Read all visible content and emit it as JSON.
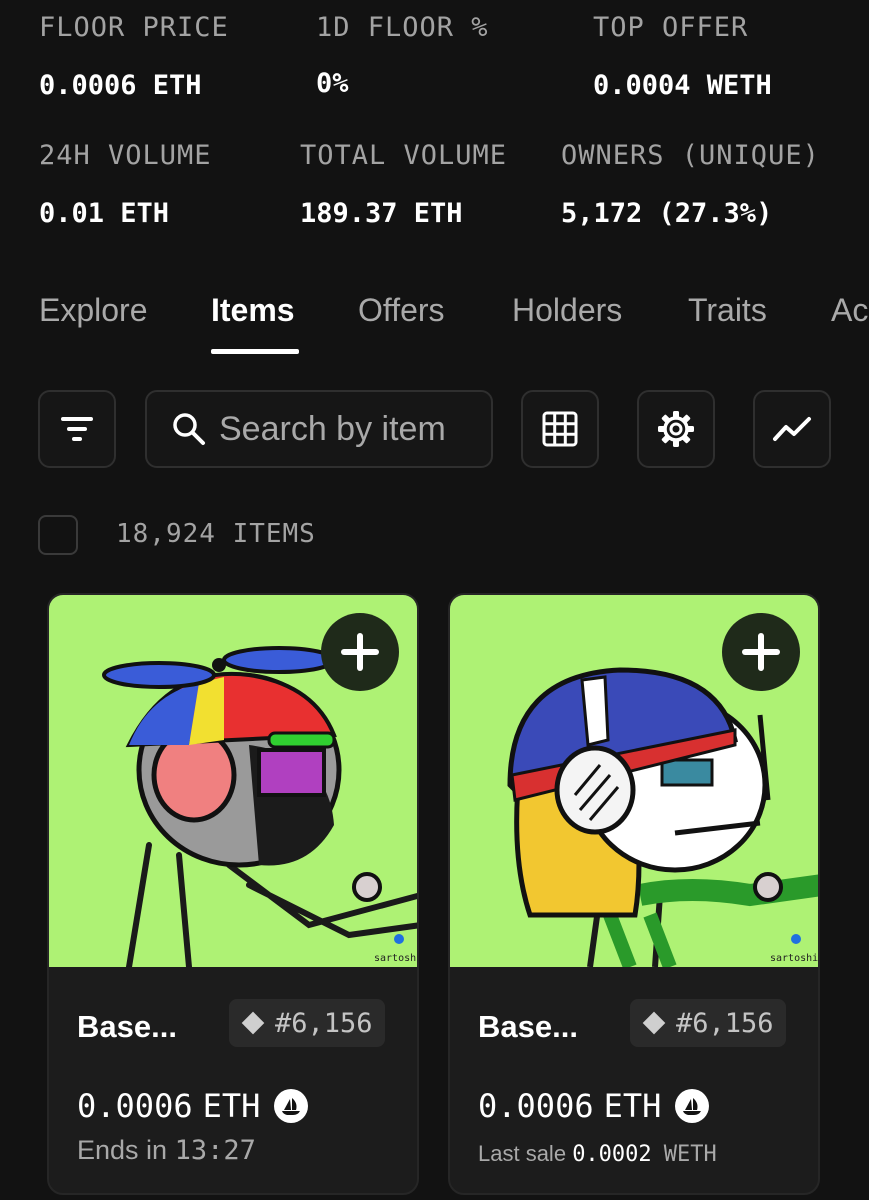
{
  "stats": {
    "floor_price_label": "FLOOR PRICE",
    "floor_price_value": "0.0006 ETH",
    "floor_change_label": "1D FLOOR %",
    "floor_change_value": "0%",
    "top_offer_label": "TOP OFFER",
    "top_offer_value": "0.0004 WETH",
    "volume_24h_label": "24H VOLUME",
    "volume_24h_value": "0.01 ETH",
    "total_volume_label": "TOTAL VOLUME",
    "total_volume_value": "189.37 ETH",
    "owners_label": "OWNERS (UNIQUE)",
    "owners_value": "5,172 (27.3%)"
  },
  "tabs": [
    {
      "label": "Explore",
      "active": false
    },
    {
      "label": "Items",
      "active": true
    },
    {
      "label": "Offers",
      "active": false
    },
    {
      "label": "Holders",
      "active": false
    },
    {
      "label": "Traits",
      "active": false
    },
    {
      "label": "Ac",
      "active": false
    }
  ],
  "toolbar": {
    "search_placeholder": "Search by item",
    "icons": [
      "filter-icon",
      "search-icon",
      "grid-icon",
      "gear-icon",
      "chart-icon"
    ]
  },
  "items_count": "18,924 ITEMS",
  "cards": [
    {
      "name": "Base...",
      "token_id": "#6,156",
      "price": "0.0006",
      "currency": "ETH",
      "sub_text": "Ends in",
      "sub_value": "13:27",
      "signature": "sartoshi"
    },
    {
      "name": "Base...",
      "token_id": "#6,156",
      "price": "0.0006",
      "currency": "ETH",
      "sub_text": "Last sale",
      "sub_value": "0.0002",
      "sub_unit": "WETH",
      "signature": "sartoshi"
    }
  ],
  "colors": {
    "background": "#121212",
    "card_art_bg": "#aef274",
    "muted_text": "#a3a3a3"
  }
}
